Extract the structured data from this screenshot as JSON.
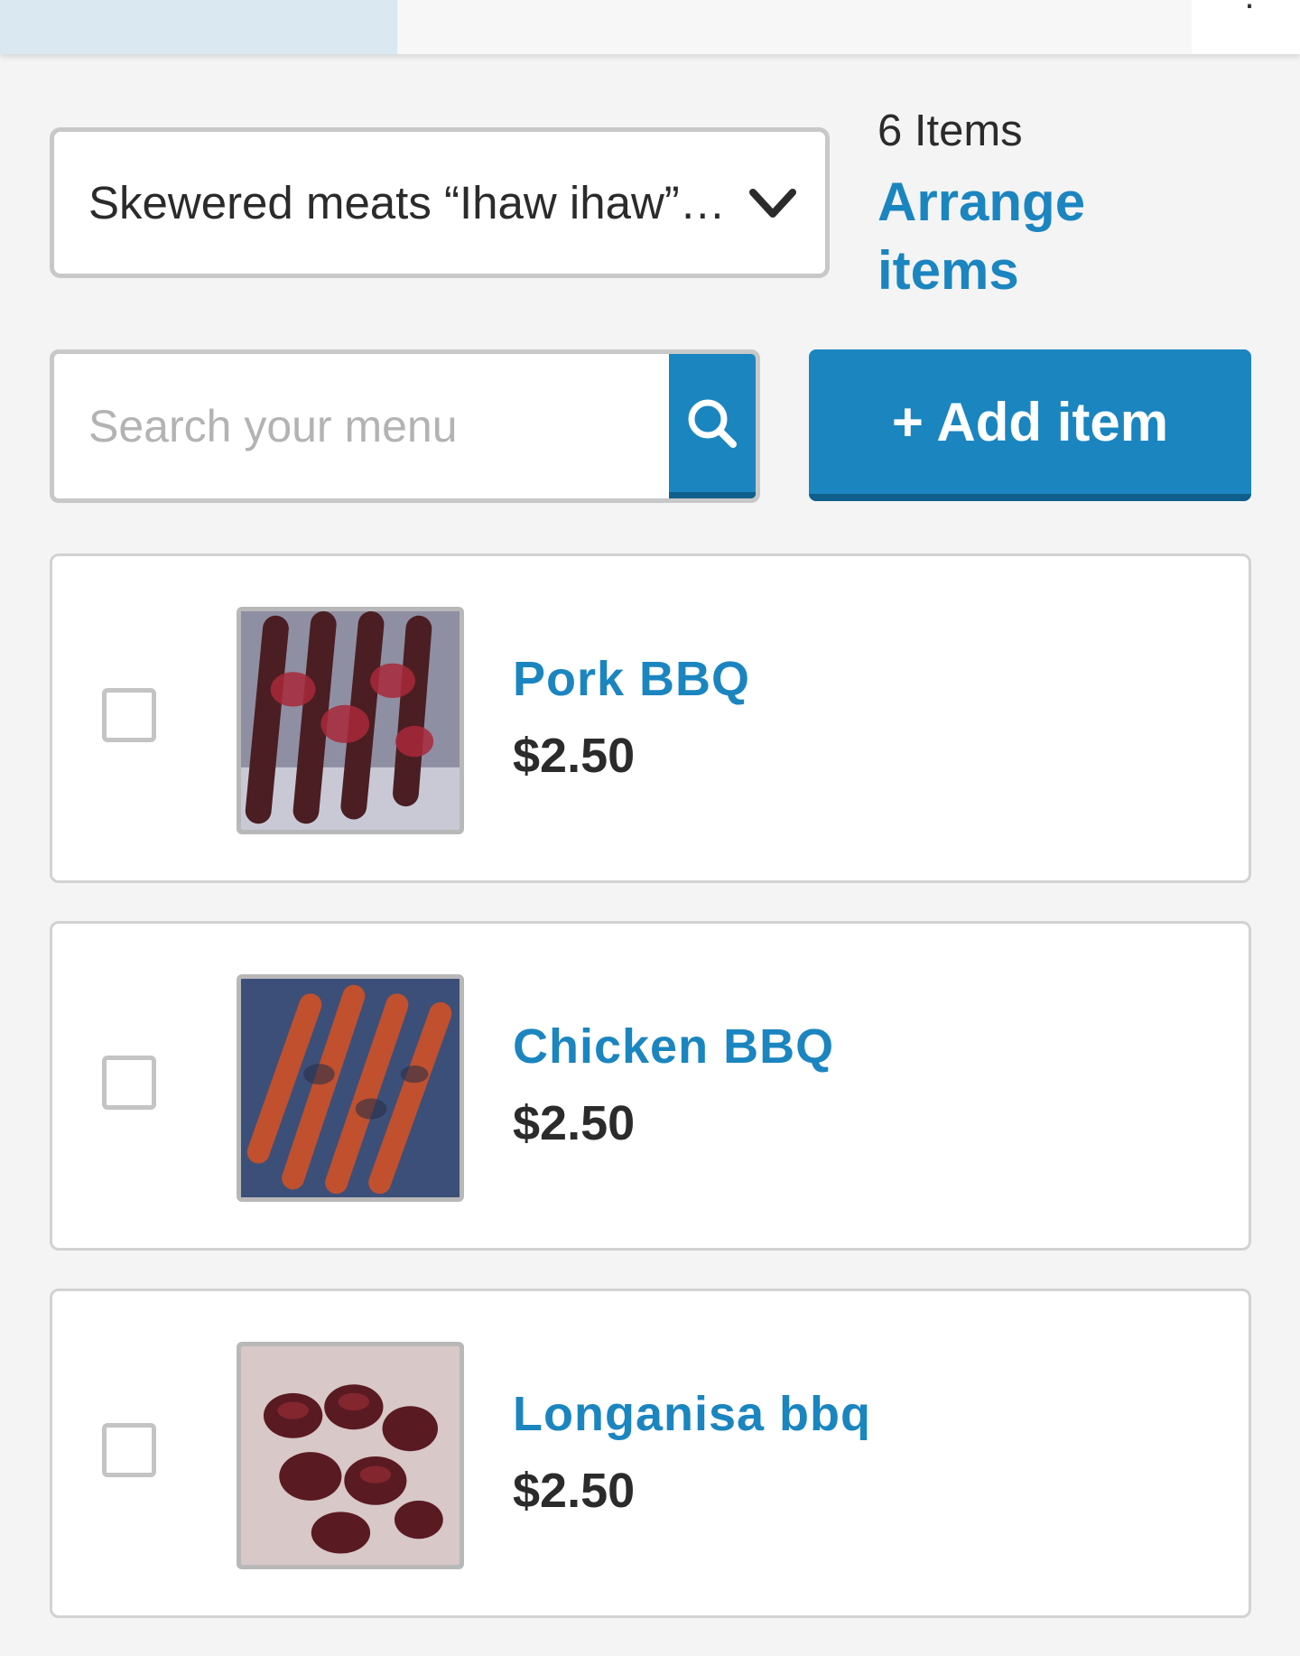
{
  "category": {
    "selected": "Skewered meats “Ihaw ihaw”…"
  },
  "summary": {
    "count_label": "6 Items",
    "arrange_label": "Arrange items"
  },
  "search": {
    "placeholder": "Search your menu"
  },
  "toolbar": {
    "add_label": "+ Add item"
  },
  "items": [
    {
      "name": "Pork BBQ",
      "price": "$2.50",
      "checked": false
    },
    {
      "name": "Chicken BBQ",
      "price": "$2.50",
      "checked": false
    },
    {
      "name": "Longanisa bbq",
      "price": "$2.50",
      "checked": false
    }
  ],
  "colors": {
    "accent": "#1b85c0",
    "accent_dark": "#0f5f8c",
    "tab_active": "#d9e8f1"
  }
}
